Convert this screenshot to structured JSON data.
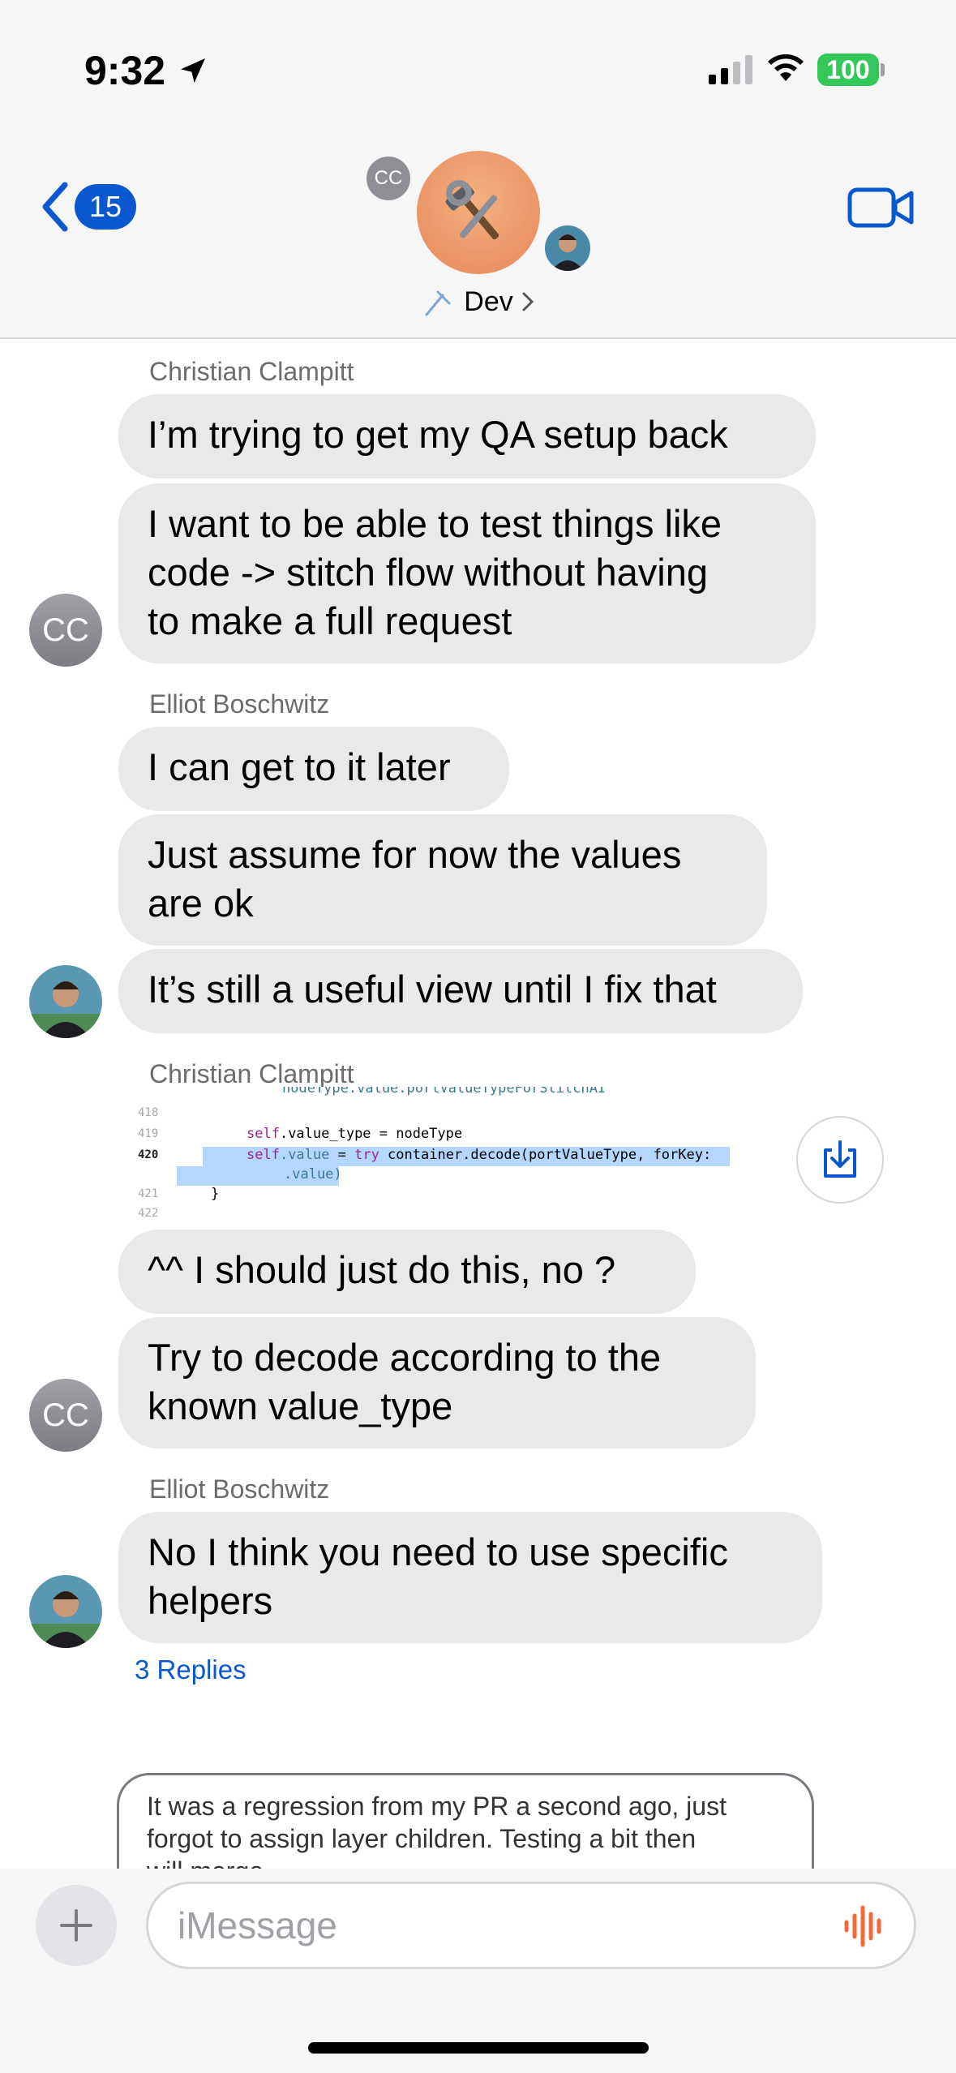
{
  "status_bar": {
    "time": "9:32",
    "battery": "100"
  },
  "header": {
    "back_count": "15",
    "group_name": "Dev",
    "member_initials": "CC",
    "icons": [
      "chevron-left-icon",
      "video-icon",
      "hammer-wrench-icon",
      "pin-icon",
      "chevron-right-icon"
    ]
  },
  "messages": {
    "group1": {
      "sender": "Christian Clampitt",
      "avatar_initials": "CC",
      "bubbles": [
        {
          "lines": [
            "I’m trying to get my QA setup back"
          ]
        },
        {
          "lines": [
            "I want to be able to test things like",
            "code -> stitch flow without having",
            "to make a full request"
          ]
        }
      ]
    },
    "group2": {
      "sender": "Elliot Boschwitz",
      "bubbles": [
        {
          "lines": [
            "I can get to it later"
          ]
        },
        {
          "lines": [
            "Just assume for now the values",
            "are ok"
          ]
        },
        {
          "lines": [
            "It’s still a useful view until I fix that"
          ]
        }
      ]
    },
    "group3": {
      "sender": "Christian Clampitt",
      "avatar_initials": "CC",
      "code": {
        "top_partial": "nodeType.value.portValueTypeForStitchAI",
        "line_numbers": [
          "418",
          "419",
          "420",
          "421",
          "422"
        ],
        "line_419": {
          "kw": "self",
          "rest": ".value_type = nodeType"
        },
        "line_420a": {
          "kw": "self",
          "prop": ".value",
          "mid": " = ",
          "kw2": "try",
          "rest": " container.decode(portValueType, forKey:"
        },
        "line_420b": ".value)",
        "line_421": "}"
      },
      "bubbles": [
        {
          "lines": [
            "^^ I should just do this, no ?"
          ]
        },
        {
          "lines": [
            "Try to decode according to the",
            "known value_type"
          ]
        }
      ]
    },
    "group4": {
      "sender": "Elliot Boschwitz",
      "bubbles": [
        {
          "lines": [
            "No I think you need to use specific",
            "helpers"
          ]
        }
      ],
      "replies": "3 Replies"
    },
    "reply_preview": {
      "lines": [
        "It was a regression from my PR a second ago, just",
        "forgot to assign layer children. Testing a bit then",
        "will merge"
      ]
    }
  },
  "composer": {
    "placeholder": "iMessage"
  },
  "colors": {
    "accent": "#0b57d0",
    "bubble_gray": "#e9e9eb",
    "battery_green": "#34c759",
    "mic_orange": "#f06a3c"
  }
}
